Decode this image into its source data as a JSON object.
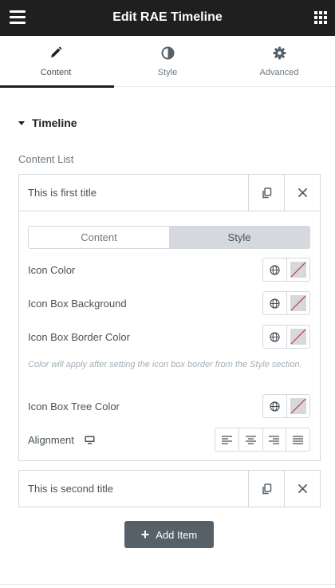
{
  "header": {
    "title": "Edit RAE Timeline",
    "menu_icon": "hamburger-icon",
    "apps_icon": "grid-icon"
  },
  "tabs": [
    {
      "label": "Content",
      "icon": "pencil-icon",
      "active": true
    },
    {
      "label": "Style",
      "icon": "half-circle-icon",
      "active": false
    },
    {
      "label": "Advanced",
      "icon": "gear-icon",
      "active": false
    }
  ],
  "section": {
    "title": "Timeline"
  },
  "content_list": {
    "label": "Content List",
    "items": [
      {
        "title": "This is first title",
        "expanded": true,
        "switcher": {
          "content_label": "Content",
          "style_label": "Style",
          "active": "Style"
        },
        "controls": {
          "icon_color": "Icon Color",
          "icon_box_background": "Icon Box Background",
          "icon_box_border_color": "Icon Box Border Color",
          "border_note": "Color will apply after setting the icon box border from the Style section.",
          "icon_box_tree_color": "Icon Box Tree Color",
          "alignment": "Alignment"
        }
      },
      {
        "title": "This is second title",
        "expanded": false
      }
    ],
    "add_item_label": "Add Item"
  },
  "colors": {
    "header_bg": "#1f1f1f",
    "active_switch_bg": "#d5d8dc",
    "add_button_bg": "#556068",
    "empty_swatch_slash": "#d0393e"
  }
}
